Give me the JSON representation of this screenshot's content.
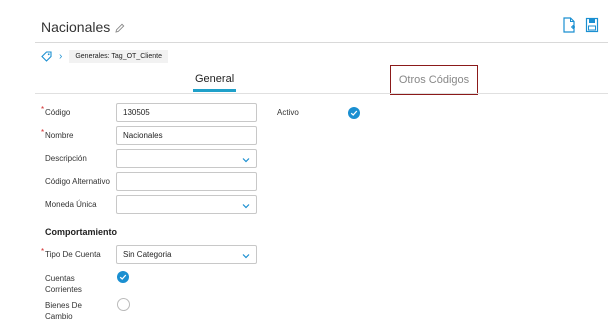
{
  "header": {
    "title": "Nacionales"
  },
  "breadcrumb": {
    "chip": "Generales: Tag_OT_Cliente"
  },
  "tabs": [
    {
      "label": "General"
    },
    {
      "label": "Otros Códigos"
    }
  ],
  "fields": {
    "codigo": {
      "label": "Código",
      "value": "130505"
    },
    "nombre": {
      "label": "Nombre",
      "value": "Nacionales"
    },
    "descripcion": {
      "label": "Descripción",
      "value": ""
    },
    "codigo_alt": {
      "label": "Código Alternativo",
      "value": ""
    },
    "moneda": {
      "label": "Moneda Única",
      "value": ""
    },
    "activo": {
      "label": "Activo"
    }
  },
  "section": {
    "title": "Comportamiento"
  },
  "behavior": {
    "tipo_cuenta": {
      "label": "Tipo De Cuenta",
      "value": "Sin Categoria"
    },
    "cuentas_corrientes": {
      "label_line1": "Cuentas",
      "label_line2": "Corrientes"
    },
    "bienes_cambio": {
      "label_line1": "Bienes De",
      "label_line2": "Cambio"
    }
  },
  "colors": {
    "accent": "#1a8fd1",
    "tab_underline": "#1fa0c9",
    "highlight_box": "#8b1a1a",
    "required": "#d32f2f"
  }
}
